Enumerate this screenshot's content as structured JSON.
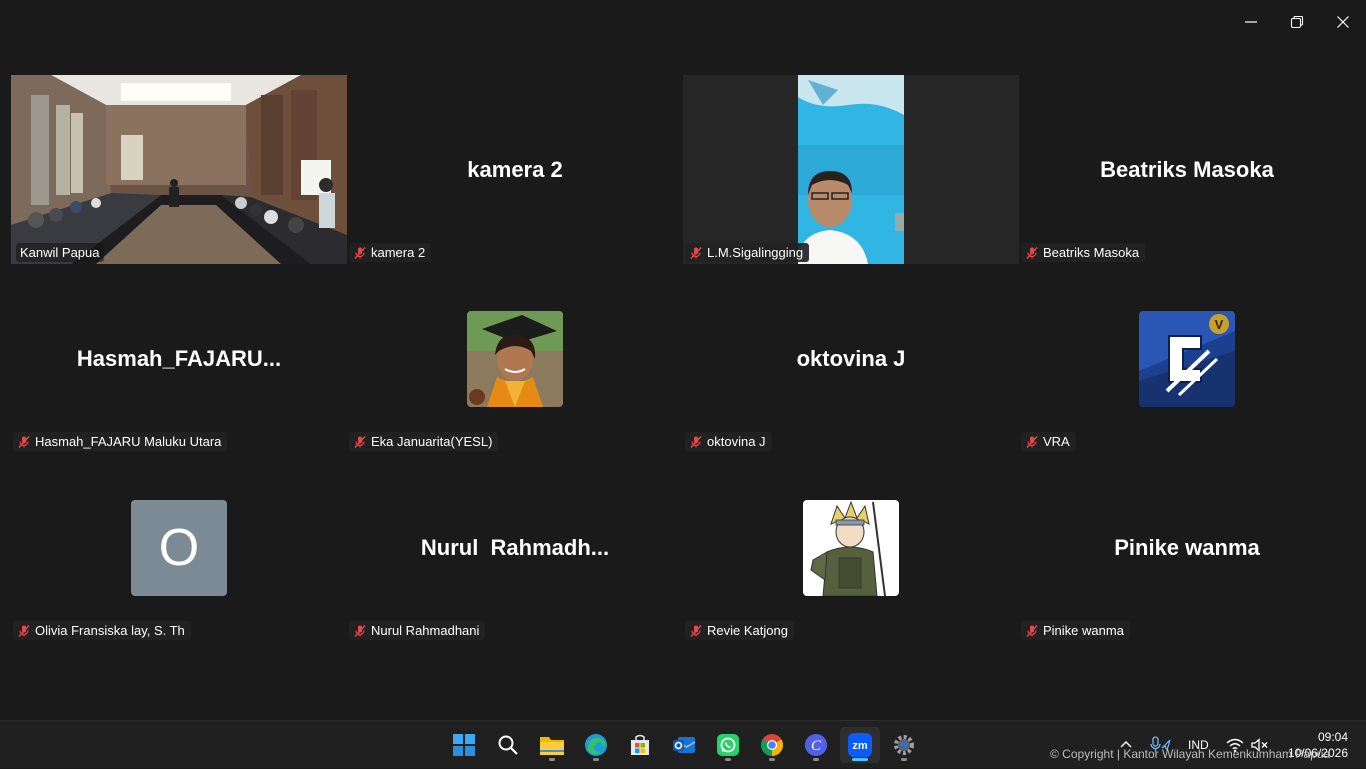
{
  "window": {
    "minimize": "minimize",
    "restore": "restore",
    "close": "close"
  },
  "participants": [
    {
      "display": "",
      "label": "Kanwil Papua",
      "muted": false,
      "kind": "video-room"
    },
    {
      "display": "kamera 2",
      "label": "kamera 2",
      "muted": true,
      "kind": "name"
    },
    {
      "display": "",
      "label": "L.M.Sigalingging",
      "muted": true,
      "kind": "video-cam"
    },
    {
      "display": "Beatriks Masoka",
      "label": "Beatriks Masoka",
      "muted": true,
      "kind": "name"
    },
    {
      "display": "Hasmah_FAJARU...",
      "label": "Hasmah_FAJARU Maluku Utara",
      "muted": true,
      "kind": "name"
    },
    {
      "display": "",
      "label": "Eka Januarita(YESL)",
      "muted": true,
      "kind": "avatar-photo"
    },
    {
      "display": "oktovina J",
      "label": "oktovina J",
      "muted": true,
      "kind": "name"
    },
    {
      "display": "",
      "label": "VRA",
      "muted": true,
      "kind": "avatar-logo"
    },
    {
      "display": "O",
      "label": "Olivia Fransiska lay, S. Th",
      "muted": true,
      "kind": "avatar-letter"
    },
    {
      "display": "Nurul  Rahmadh...",
      "label": "Nurul Rahmadhani",
      "muted": true,
      "kind": "name"
    },
    {
      "display": "",
      "label": "Revie Katjong",
      "muted": true,
      "kind": "avatar-anime"
    },
    {
      "display": "Pinike wanma",
      "label": "Pinike wanma",
      "muted": true,
      "kind": "name"
    }
  ],
  "taskbar": {
    "apps": [
      "windows-start",
      "search",
      "file-explorer",
      "edge",
      "microsoft-store",
      "outlook",
      "whatsapp",
      "chrome",
      "canva",
      "zoom",
      "settings"
    ],
    "tray": {
      "language": "IND"
    },
    "clock": {
      "time": "09:04",
      "date": "10/06/2026"
    }
  },
  "watermark": "© Copyright | Kantor Wilayah Kemenkumham Papua",
  "colors": {
    "active_border": "#22c55e",
    "mute_red": "#e5484d",
    "taskbar": "#202020",
    "background": "#1a1a1a"
  }
}
